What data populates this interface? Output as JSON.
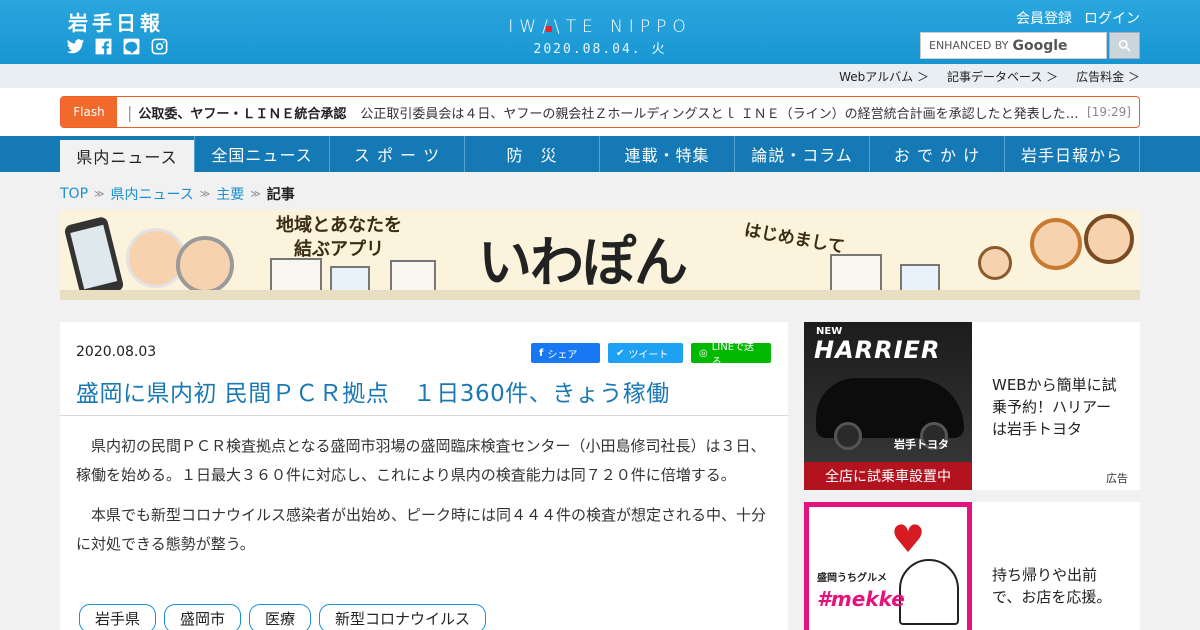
{
  "header": {
    "logo_jp": "岩手日報",
    "brand_left": "IW",
    "brand_right": "TE NIPPO",
    "date": "2020.08.04. 火",
    "register": "会員登録",
    "login": "ログイン",
    "search_label": "ENHANCED BY",
    "search_brand": "Google",
    "sns": [
      "twitter-icon",
      "facebook-icon",
      "line-icon",
      "instagram-icon"
    ]
  },
  "sublinks": [
    "Webアルバム ＞",
    "記事データベース ＞",
    "広告料金 ＞"
  ],
  "flash": {
    "tag": "Flash",
    "headline": "公取委、ヤフー・ＬＩＮＥ統合承認",
    "body": "公正取引委員会は４日、ヤフーの親会社Ｚホールディングスとｌ ＩＮＥ（ライン）の経営統合計画を承認したと発表した。…",
    "time": "[19:29]"
  },
  "nav": [
    "県内ニュース",
    "全国ニュース",
    "ス ポ ー ツ",
    "防　災",
    "連載・特集",
    "論説・コラム",
    "お で か け",
    "岩手日報から"
  ],
  "breadcrumb": {
    "top": "TOP",
    "cat": "県内ニュース",
    "sub": "主要",
    "current": "記事"
  },
  "banner": {
    "copy1": "地域とあなたを",
    "copy2": "結ぶアプリ",
    "app": "いわぽん",
    "hello": "はじめまして"
  },
  "article": {
    "date": "2020.08.03",
    "share_fb": "シェア",
    "share_tw": "ツイート",
    "share_line": "LINEで送る",
    "title": "盛岡に県内初 民間ＰＣＲ拠点　１日360件、きょう稼働",
    "paragraphs": [
      "県内初の民間ＰＣＲ検査拠点となる盛岡市羽場の盛岡臨床検査センター（小田島修司社長）は３日、稼働を始める。１日最大３６０件に対応し、これにより県内の検査能力は同７２０件に倍増する。",
      "本県でも新型コロナウイルス感染者が出始め、ピーク時には同４４４件の検査が想定される中、十分に対処できる態勢が整う。"
    ],
    "tags": [
      "岩手県",
      "盛岡市",
      "医療",
      "新型コロナウイルス"
    ]
  },
  "ads": [
    {
      "nw": "NEW",
      "model": "HARRIER",
      "dealer": "岩手トヨタ",
      "strip": "全店に試乗車設置中",
      "text": "WEBから簡単に試乗予約！ハリアーは岩手トヨタ",
      "label": "広告"
    },
    {
      "gurume": "盛岡うちグルメ",
      "mekke": "#mekke",
      "text": "持ち帰りや出前で、お店を応援。"
    }
  ],
  "colors": {
    "header": "#1896d2",
    "nav": "#1479b5",
    "flash": "#f16a2c",
    "link": "#1a8fd1",
    "title": "#1a79b5"
  }
}
